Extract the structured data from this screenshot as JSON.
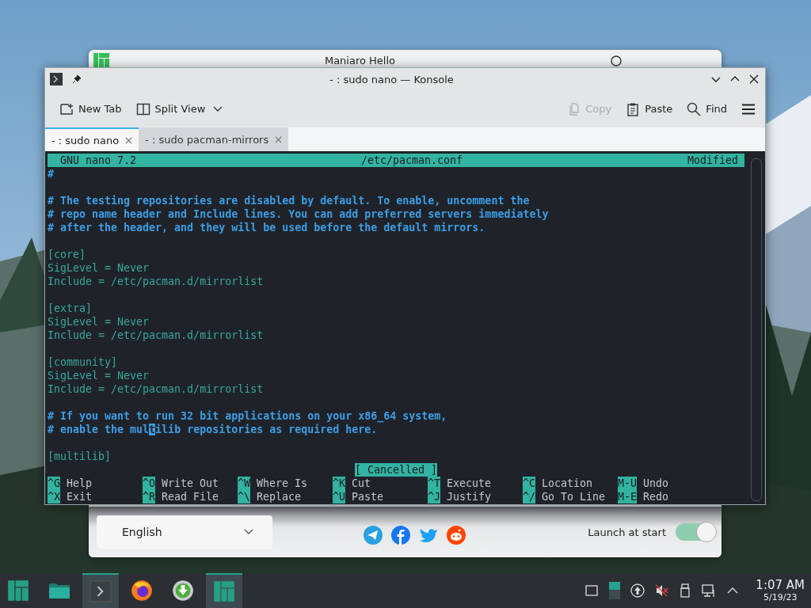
{
  "hello_window": {
    "title": "Maniaro Hello",
    "language": "English",
    "launch_at_start": {
      "label": "Launch at start",
      "on": true
    }
  },
  "konsole": {
    "title": "- : sudo nano — Konsole",
    "toolbar_left": [
      {
        "kind": "new-tab",
        "label": "New Tab",
        "disabled": false
      },
      {
        "kind": "split-view",
        "label": "Split View",
        "disabled": false
      }
    ],
    "toolbar_right": [
      {
        "kind": "copy",
        "label": "Copy",
        "disabled": true
      },
      {
        "kind": "paste",
        "label": "Paste",
        "disabled": false
      },
      {
        "kind": "find",
        "label": "Find",
        "disabled": false
      }
    ],
    "tabs": [
      {
        "label": "- : sudo nano",
        "selected": true
      },
      {
        "label": "- : sudo pacman-mirrors",
        "selected": false
      }
    ],
    "nano": {
      "header": {
        "version": "GNU nano 7.2",
        "file": "/etc/pacman.conf",
        "status": "Modified"
      },
      "lines": [
        {
          "kind": "comment",
          "text": "#"
        },
        {
          "kind": "blank"
        },
        {
          "kind": "comment",
          "text": "# The testing repositories are disabled by default. To enable, uncomment the"
        },
        {
          "kind": "comment",
          "text": "# repo name header and Include lines. You can add preferred servers immediately"
        },
        {
          "kind": "comment",
          "text": "# after the header, and they will be used before the default mirrors."
        },
        {
          "kind": "blank"
        },
        {
          "kind": "setting",
          "text": "[core]"
        },
        {
          "kind": "setting",
          "text": "SigLevel = Never"
        },
        {
          "kind": "setting",
          "text": "Include = /etc/pacman.d/mirrorlist"
        },
        {
          "kind": "blank"
        },
        {
          "kind": "setting",
          "text": "[extra]"
        },
        {
          "kind": "setting",
          "text": "SigLevel = Never"
        },
        {
          "kind": "setting",
          "text": "Include = /etc/pacman.d/mirrorlist"
        },
        {
          "kind": "blank"
        },
        {
          "kind": "setting",
          "text": "[community]"
        },
        {
          "kind": "setting",
          "text": "SigLevel = Never"
        },
        {
          "kind": "setting",
          "text": "Include = /etc/pacman.d/mirrorlist"
        },
        {
          "kind": "blank"
        },
        {
          "kind": "comment",
          "text": "# If you want to run 32 bit applications on your x86_64 system,"
        },
        {
          "kind": "comment",
          "text": "# enable the mul",
          "cursor": "t",
          "after": "ilib repositories as required here."
        },
        {
          "kind": "blank"
        },
        {
          "kind": "setting",
          "text": "[multilib]"
        }
      ],
      "message": "[ Cancelled ]",
      "shortcuts": [
        {
          "key": "^G",
          "label": "Help"
        },
        {
          "key": "^O",
          "label": "Write Out"
        },
        {
          "key": "^W",
          "label": "Where Is"
        },
        {
          "key": "^K",
          "label": "Cut"
        },
        {
          "key": "^T",
          "label": "Execute"
        },
        {
          "key": "^C",
          "label": "Location"
        },
        {
          "key": "M-U",
          "label": "Undo"
        },
        {
          "key": "^X",
          "label": "Exit"
        },
        {
          "key": "^R",
          "label": "Read File"
        },
        {
          "key": "^\\",
          "label": "Replace"
        },
        {
          "key": "^U",
          "label": "Paste"
        },
        {
          "key": "^J",
          "label": "Justify"
        },
        {
          "key": "^/",
          "label": "Go To Line"
        },
        {
          "key": "M-E",
          "label": "Redo"
        }
      ]
    }
  },
  "taskbar": {
    "tasks": [
      {
        "kind": "launcher",
        "selected": false
      },
      {
        "kind": "files",
        "selected": false
      },
      {
        "kind": "terminal",
        "selected": true
      },
      {
        "kind": "browser",
        "selected": false
      },
      {
        "kind": "download",
        "selected": false
      },
      {
        "kind": "hello",
        "selected": true
      }
    ],
    "clock": {
      "time": "1:07 AM",
      "date": "5/19/23"
    }
  }
}
